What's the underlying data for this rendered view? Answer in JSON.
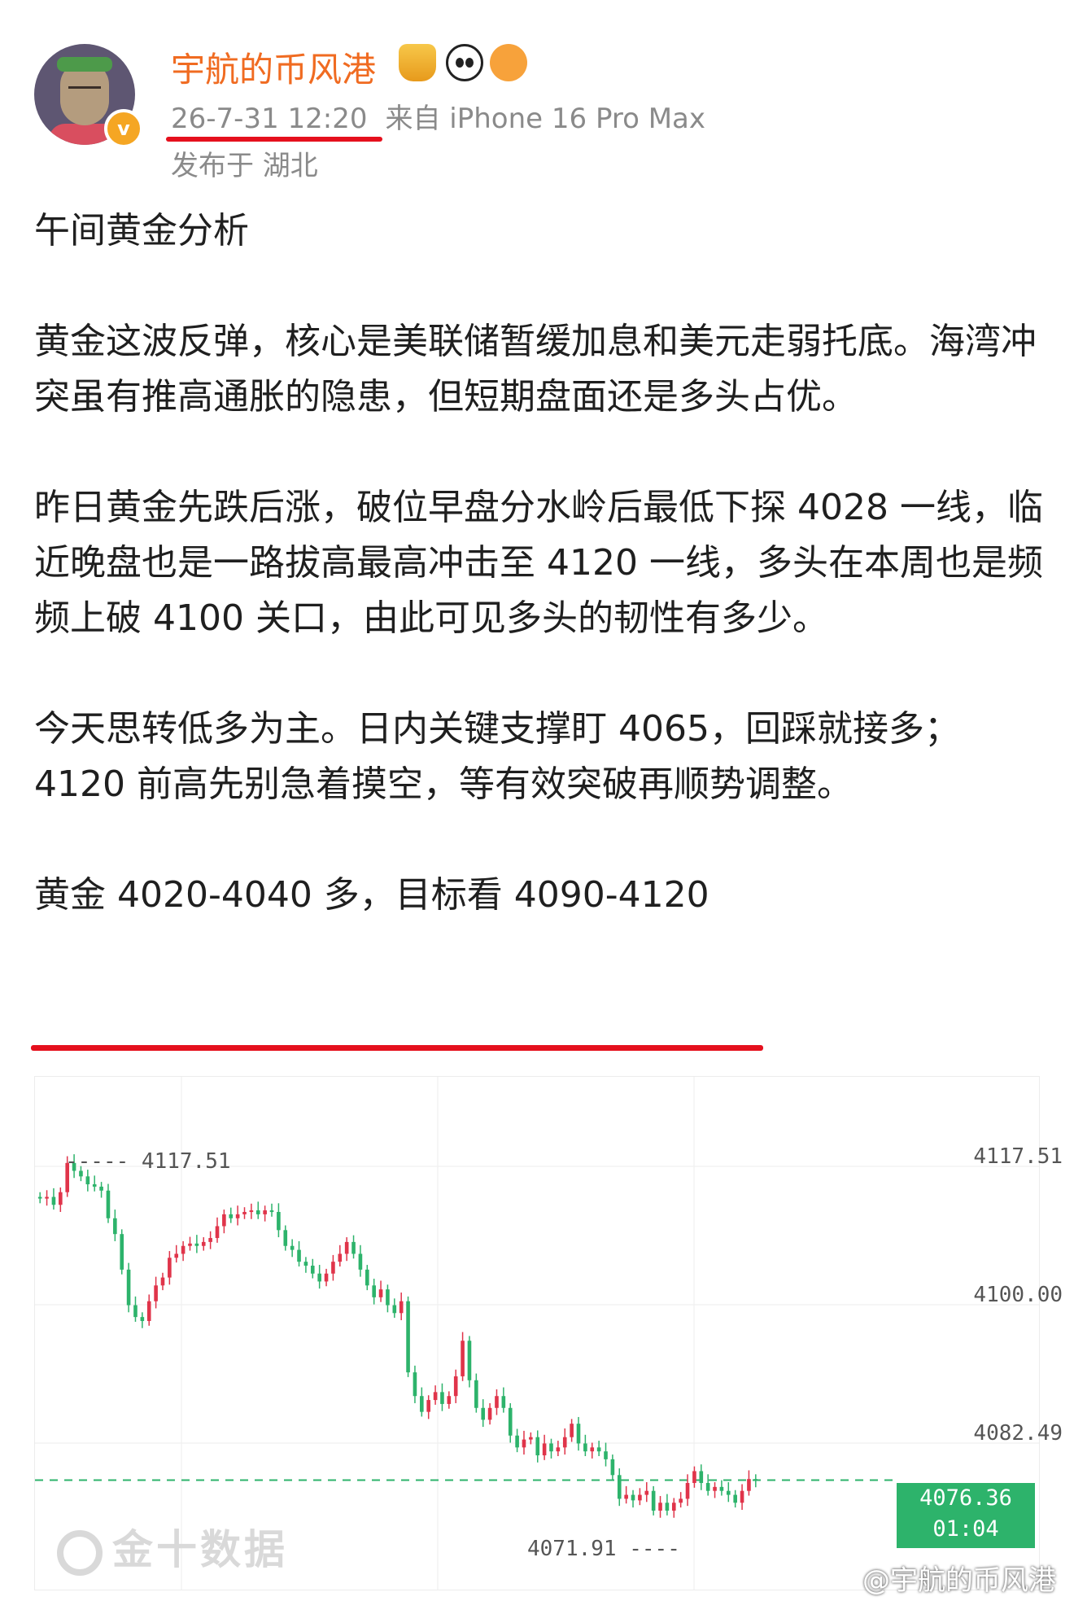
{
  "post": {
    "username": "宇航的币风港",
    "time": "26-7-31 12:20",
    "source": "来自 iPhone 16 Pro Max",
    "location": "发布于 湖北",
    "paragraphs": [
      "午间黄金分析",
      "黄金这波反弹，核心是美联储暂缓加息和美元走弱托底。海湾冲突虽有推高通胀的隐患，但短期盘面还是多头占优。",
      "昨日黄金先跌后涨，破位早盘分水岭后最低下探 4028 一线，临近晚盘也是一路拔高最高冲击至 4120 一线，多头在本周也是频频上破 4100 关口，由此可见多头的韧性有多少。",
      "今天思转低多为主。日内关键支撑盯 4065，回踩就接多；4120 前高先别急着摸空，等有效突破再顺势调整。",
      "黄金 4020-4040 多，目标看 4090-4120"
    ],
    "badges": [
      "crown-emoji",
      "panda-emoji",
      "fish-emoji"
    ],
    "verified_badge": "v",
    "accent_color": "#f06b21",
    "highlight_color": "#e5101d"
  },
  "chart_data": {
    "type": "candlestick",
    "yticks": [
      "4117.51",
      "4100.00",
      "4082.49"
    ],
    "high_label": "4117.51",
    "low_label": "4071.91",
    "current_price": "4076.36",
    "countdown": "01:04",
    "watermark": "金十数据",
    "up_color": "#e0344a",
    "down_color": "#2db36b",
    "ylim": [
      4068,
      4123
    ],
    "closes": [
      4112.0,
      4112.2,
      4111.2,
      4112.8,
      4116.5,
      4115.5,
      4114.8,
      4113.8,
      4113.5,
      4113.0,
      4109.5,
      4107.5,
      4103.0,
      4098.5,
      4097.0,
      4096.5,
      4099.0,
      4101.0,
      4102.0,
      4104.5,
      4105.0,
      4106.0,
      4106.3,
      4106.0,
      4106.5,
      4107.0,
      4108.5,
      4110.0,
      4109.5,
      4110.0,
      4110.3,
      4110.5,
      4110.0,
      4110.5,
      4110.3,
      4108.0,
      4106.0,
      4105.5,
      4104.0,
      4103.5,
      4102.5,
      4101.5,
      4102.5,
      4104.0,
      4105.0,
      4106.5,
      4105.0,
      4103.0,
      4101.0,
      4099.5,
      4100.5,
      4098.5,
      4097.5,
      4099.0,
      4090.0,
      4087.0,
      4085.0,
      4086.5,
      4087.5,
      4086.0,
      4087.0,
      4089.5,
      4094.0,
      4089.0,
      4085.5,
      4084.0,
      4085.5,
      4087.0,
      4085.5,
      4082.0,
      4080.5,
      4081.5,
      4081.8,
      4079.5,
      4081.0,
      4080.0,
      4080.5,
      4081.8,
      4083.5,
      4081.0,
      4080.0,
      4080.5,
      4080.0,
      4079.0,
      4077.0,
      4074.0,
      4074.5,
      4073.8,
      4074.5,
      4075.0,
      4072.5,
      4073.5,
      4072.5,
      4073.5,
      4074.0,
      4076.0,
      4077.5,
      4076.0,
      4075.0,
      4075.5,
      4075.0,
      4074.5,
      4073.5,
      4075.0,
      4076.5,
      4076.36
    ]
  }
}
